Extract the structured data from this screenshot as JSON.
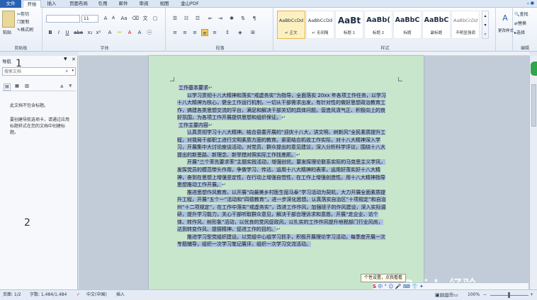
{
  "menubar": {
    "tabs": [
      "文件",
      "开始",
      "插入",
      "页面布局",
      "引用",
      "邮件",
      "审阅",
      "视图",
      "金山PDF"
    ]
  },
  "clipboard": {
    "paste": "粘贴",
    "cut": "剪切",
    "copy": "复制",
    "format_painter": "格式刷",
    "label": "剪贴板"
  },
  "font": {
    "name": "",
    "size": "11",
    "label": "字体"
  },
  "paragraph": {
    "label": "段落"
  },
  "styles": {
    "label": "样式",
    "items": [
      {
        "sample": "AaBbCcDd",
        "name": "↵ 正文"
      },
      {
        "sample": "AaBbCcDd",
        "name": "↵ 无间隔"
      },
      {
        "sample": "AaBt",
        "name": "标题 1"
      },
      {
        "sample": "AaBb(",
        "name": "标题 2"
      },
      {
        "sample": "AaBbC",
        "name": "标题"
      },
      {
        "sample": "AaBbC",
        "name": "副标题"
      },
      {
        "sample": "AaBbCcDd",
        "name": "不明显强调"
      }
    ],
    "change": "更改样式"
  },
  "editing": {
    "find": "查找",
    "replace": "替换",
    "select": "选择",
    "label": "编辑"
  },
  "nav": {
    "title": "导航",
    "search_placeholder": "搜索文档",
    "no_headings": "此文档不包含标题。",
    "hint": "要创建导航选项卡，请通过应用标题样式在您的文档中创建标题。"
  },
  "markers": {
    "one": "1",
    "two": "2"
  },
  "document": {
    "paragraphs": [
      "工作基本要求",
      "以学习贯彻十八大精神和落实“戒虚务实”为指导，全面落实 20xx 年各项工作任务，以学习十八大精神为核心，健全工作运行机制，一切从干部需求出发，有针对性的做好思想政治教育工作，搞建各类思想交流的平台，满足和解决干部关切的具体问题，营造风清气正、积极向上的良好氛围，为各项工作开展提供思想和组织保证。",
      "工作主要内容",
      "认真贯彻学习十八大精神。结合县委开展的“迎庆十八大，讲文明、树新风”全民素质提升工程，对我局干部职工进行文明素质方面的教育。紧密结合机收工作实际，对十八大精神深入学习，开展集中大讨论座谈活动，对党员、群众提出的意见建议，深入分析科学评议，围绕十八大提出的新思路、新理念、新举措对照实际工作找差距。",
      "开展“三个率先要求率”主题实践活动，增强创优。要发挥理论联系实际的马克思主义学风，发挥党员的模范带头作用，争做学习、传达、运用十八大精神的表率，运用好落实好十八大精神，奋到在思想上增强坚定性，在行动上增强自觉性，在工作上增强创造性。用十八大精神指导思想推动工作开展。",
      "推进思想作风教育。以开展“向最美乡村医生屈马泰”学习活动为契机，大力开展全面素质提升工程，开展“五个一”活动和“四德教育”，进一步深化思想。认真落实自治区“十项规定”和自治州“十二项规定”，在工作中落实“戒虚务实”，改进工作作风，加强班子的作风建设，深入实际调研，提升学习能力，关心干部听取群众意见，解决干部合理诉求和意愿。开展“走企业、访个体、转作风、树形象”活动，以优良的党风促政风，以扎实的工作作风提升地税部门行业风尚，达到转变作风、提振精神、促进工作的目的。",
      "推进学习型党组织建设。以党组中心组学习抓手，积极开展理论学习活动，每季度开展一次专题辅导，组织一次学习笔记展评，组织一次学习交流活动。"
    ]
  },
  "tooltip": "个性设置，点我看看",
  "status": {
    "page": "页面: 1/2",
    "words": "字数: 1,484/1,484",
    "lang": "中文(中国)",
    "mode": "插入",
    "zoom": "100%"
  },
  "watermark": "Baidu经验"
}
